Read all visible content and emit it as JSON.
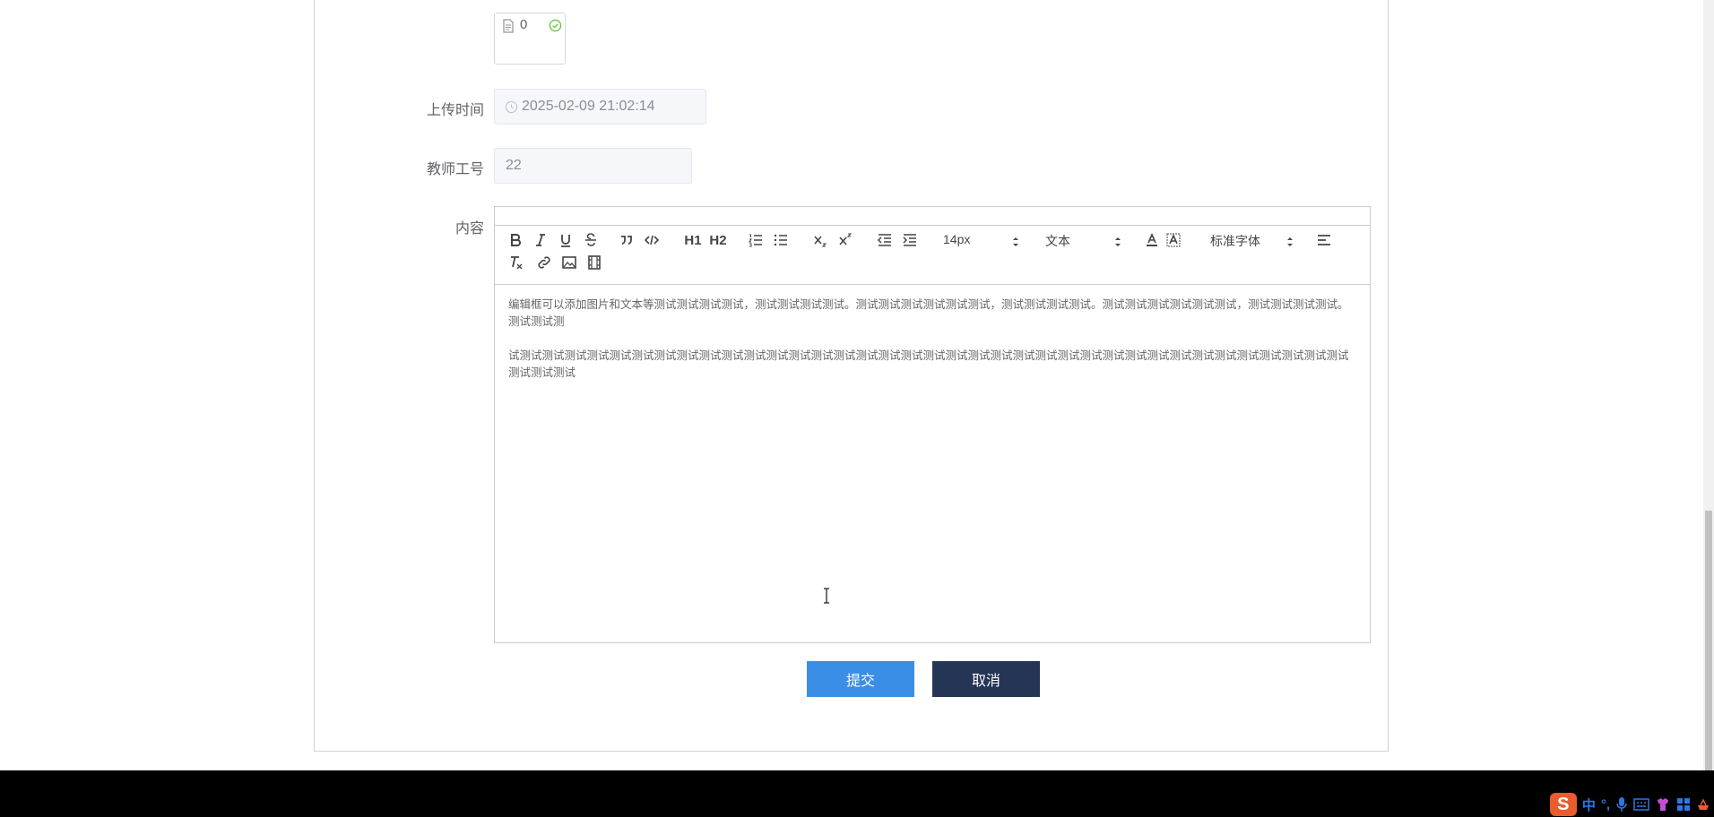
{
  "file": {
    "count": "0"
  },
  "fields": {
    "upload_time_label": "上传时间",
    "upload_time_value": "2025-02-09 21:02:14",
    "teacher_id_label": "教师工号",
    "teacher_id_value": "22",
    "content_label": "内容"
  },
  "editor": {
    "toolbar": {
      "size": "14px",
      "header": "文本",
      "font": "标准字体",
      "h1": "H1",
      "h2": "H2"
    },
    "paragraphs": [
      "编辑框可以添加图片和文本等测试测试测试测试，测试测试测试测试。测试测试测试测试测试测试，测试测试测试测试。测试测试测试测试测试测试，测试测试测试测试。测试测试测",
      "试测试测试测试测试测试测试测试测试测试测试测试测试测试测试测试测试测试测试测试测试测试测试测试测试测试测试测试测试测试测试测试测试测试测试测试测试测试测试测试测试"
    ]
  },
  "buttons": {
    "submit": "提交",
    "cancel": "取消"
  },
  "tray": {
    "ime": "中"
  },
  "colors": {
    "submit": "#3a8ee6",
    "cancel": "#253556",
    "check": "#67c23a"
  }
}
